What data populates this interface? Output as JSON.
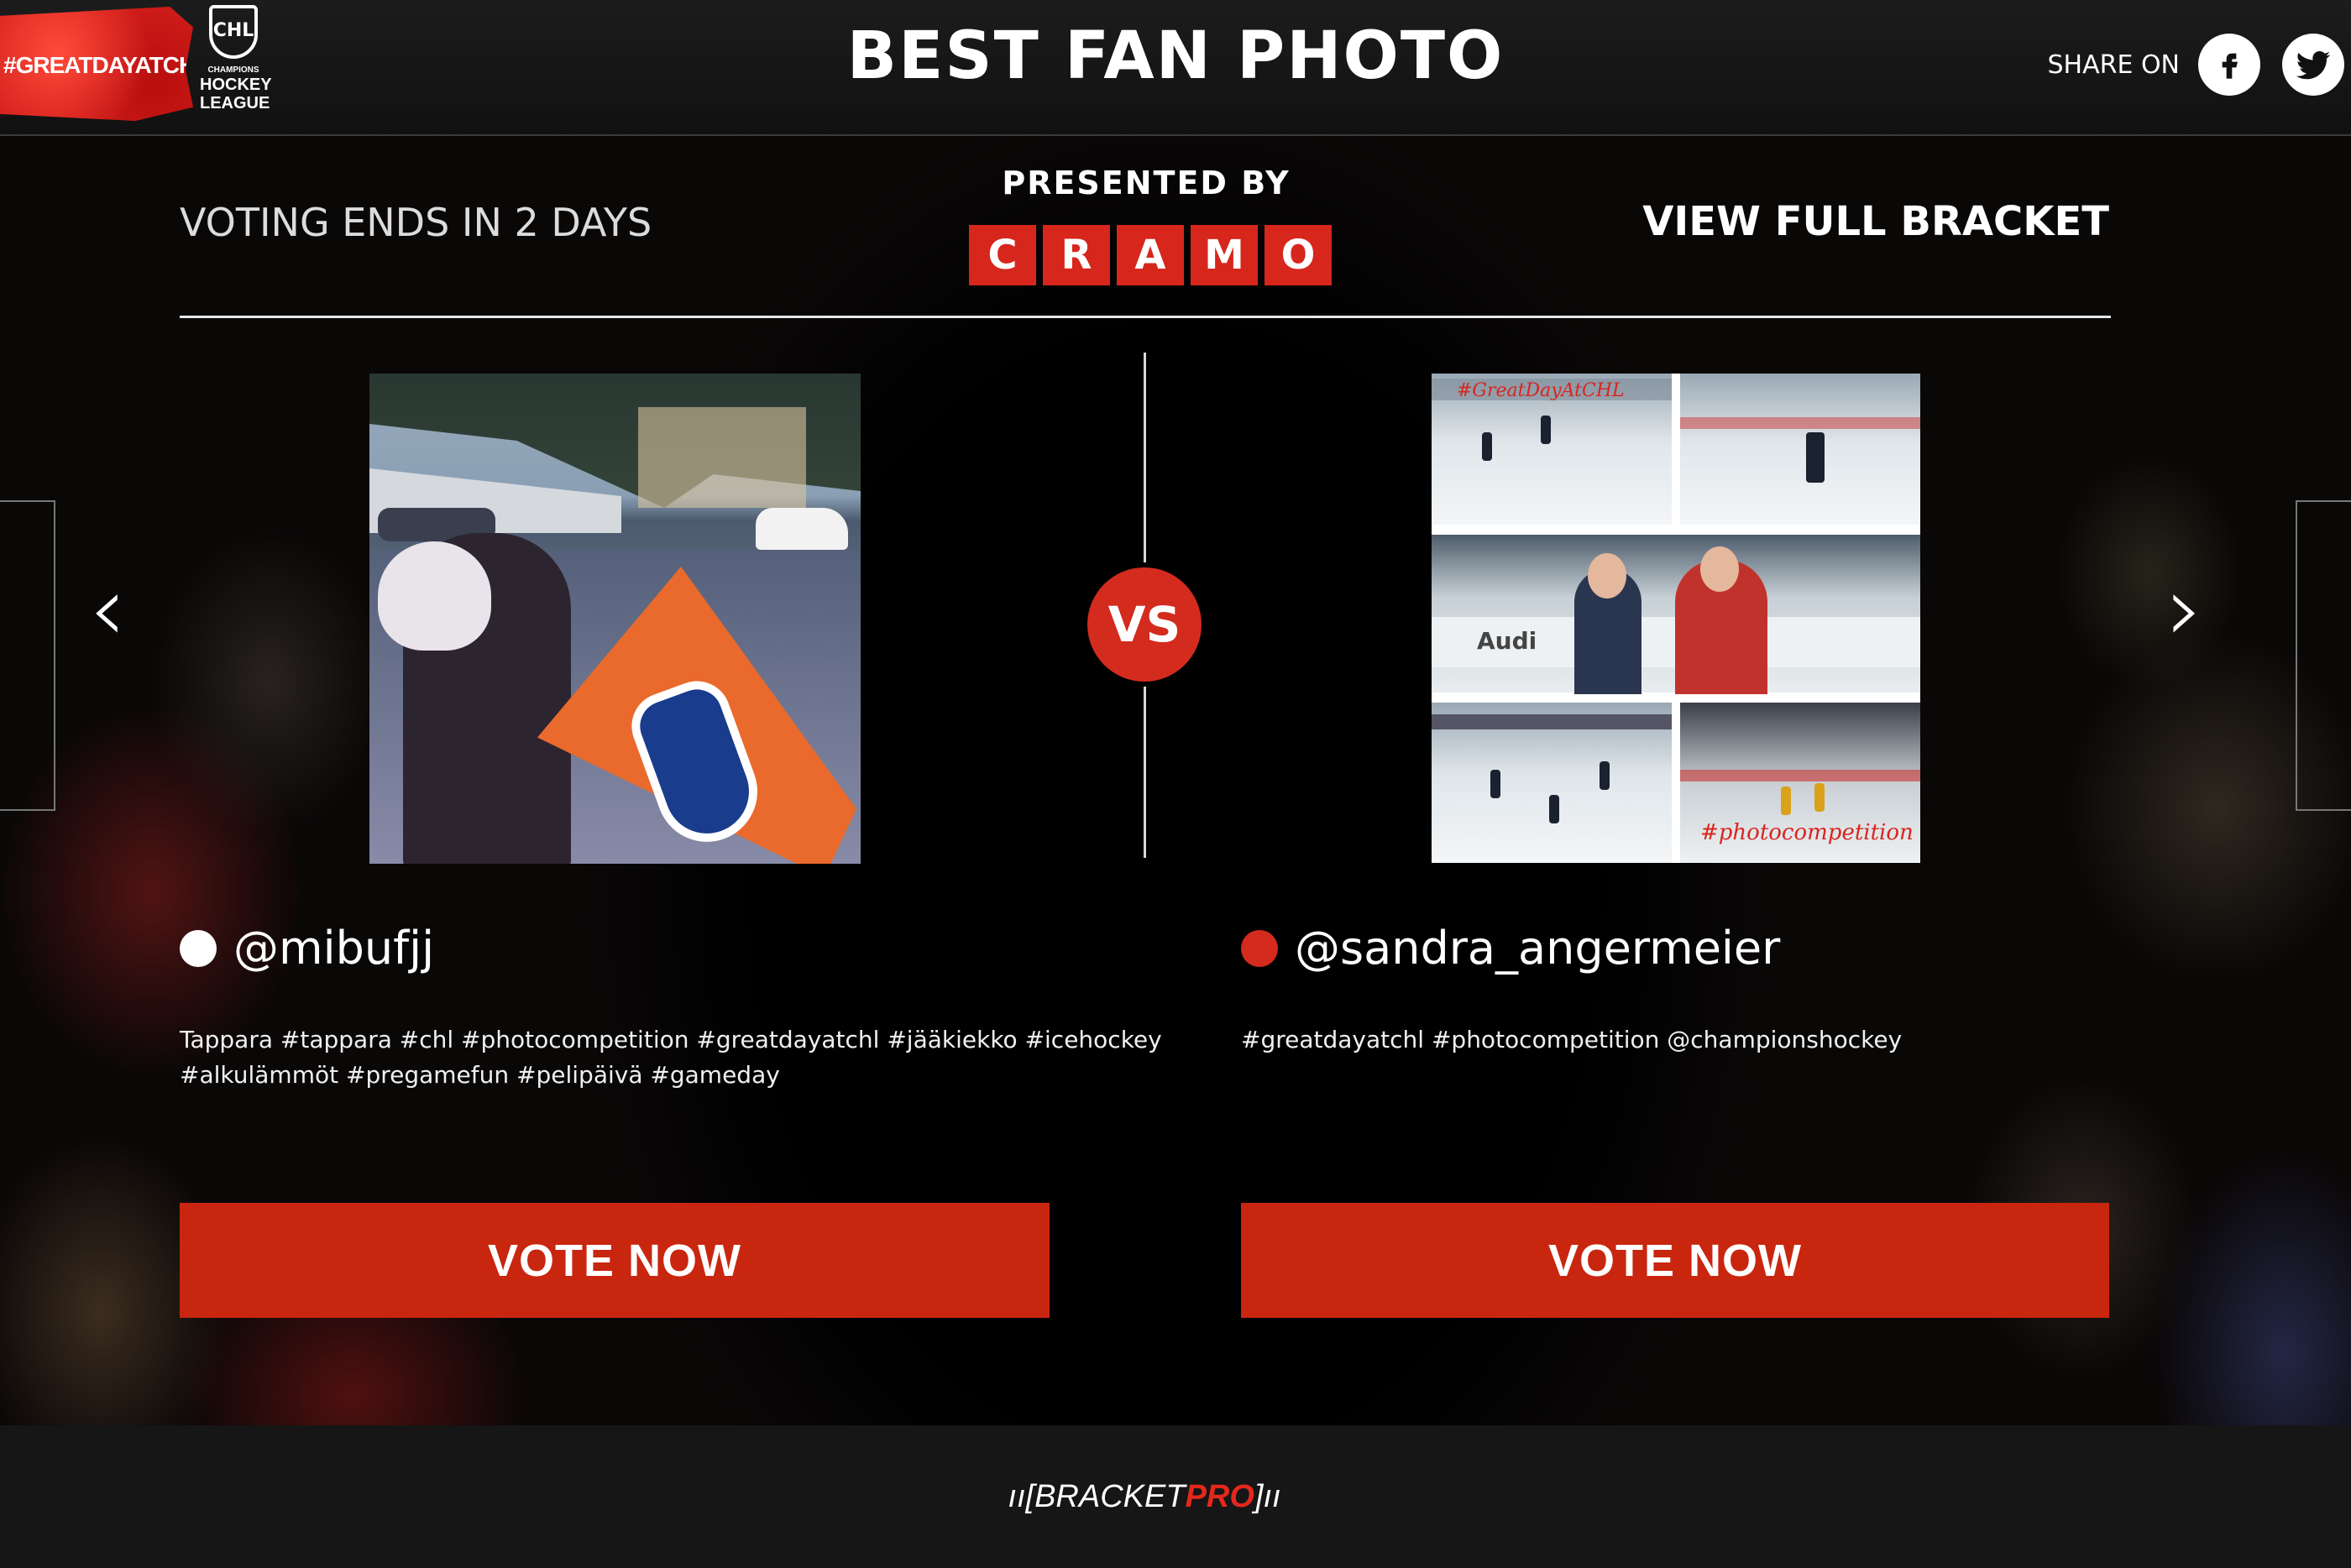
{
  "header": {
    "hashtag": "#GREATDAYATCHL",
    "logo": {
      "mark": "CHL",
      "small": "CHAMPIONS",
      "line1": "HOCKEY",
      "line2": "LEAGUE"
    },
    "title": "BEST FAN PHOTO",
    "share_label": "SHARE ON",
    "share_icons": [
      "facebook-icon",
      "twitter-icon"
    ]
  },
  "subheader": {
    "voting_status": "VOTING ENDS IN 2 DAYS",
    "presented_by": "PRESENTED BY",
    "sponsor_letters": [
      "C",
      "R",
      "A",
      "M",
      "O"
    ],
    "view_bracket": "VIEW FULL BRACKET"
  },
  "matchup": {
    "vs_label": "VS",
    "left": {
      "username": "@mibufjj",
      "dot_color": "#ffffff",
      "caption_line1": "Tappara #tappara #chl #photocompetition #greatdayatchl #jääkiekko #icehockey",
      "caption_line2": "#alkulämmöt #pregamefun #pelipäivä #gameday",
      "vote_label": "VOTE NOW"
    },
    "right": {
      "username": "@sandra_angermeier",
      "dot_color": "#d32b1e",
      "caption_line1": "#greatdayatchl #photocompetition @championshockey",
      "vote_label": "VOTE NOW",
      "photo_tags": [
        "#GreatDayAtCHL",
        "#photocompetition"
      ],
      "photo_ad": "Audi"
    }
  },
  "navigation": {
    "prev_glyph": "‹",
    "next_glyph": "›"
  },
  "footer": {
    "brand_prefix": "BRACKET",
    "brand_suffix": "PRO"
  },
  "colors": {
    "accent": "#c9260f",
    "sponsor": "#d7261c",
    "vs": "#d32b1e"
  }
}
